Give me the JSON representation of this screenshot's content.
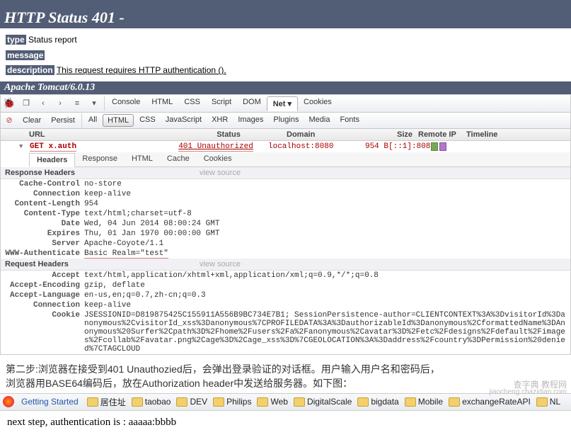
{
  "status": {
    "title": "HTTP Status 401 -",
    "type_label": "type",
    "type_value": "Status report",
    "message_label": "message",
    "description_label": "description",
    "description_value": "This request requires HTTP authentication ().",
    "server": "Apache Tomcat/6.0.13"
  },
  "firebug": {
    "top_tabs": [
      "Console",
      "HTML",
      "CSS",
      "Script",
      "DOM",
      "Net",
      "Cookies"
    ],
    "top_active": "Net",
    "row2_buttons": [
      "Clear",
      "Persist"
    ],
    "row2_filters": [
      "All",
      "HTML",
      "CSS",
      "JavaScript",
      "XHR",
      "Images",
      "Plugins",
      "Media",
      "Fonts"
    ],
    "row2_active": "HTML",
    "net_cols": [
      "URL",
      "Status",
      "Domain",
      "Size",
      "Remote IP",
      "Timeline"
    ],
    "req": {
      "method": "GET",
      "url": "x.auth",
      "status": "401 Unauthorized",
      "domain": "localhost:8080",
      "size": "954 B",
      "remote_ip": "[::1]:8080"
    },
    "subtabs": [
      "Headers",
      "Response",
      "HTML",
      "Cache",
      "Cookies"
    ],
    "subtab_active": "Headers",
    "response_headers_title": "Response Headers",
    "request_headers_title": "Request Headers",
    "view_source": "view source",
    "response_headers": [
      {
        "k": "Cache-Control",
        "v": "no-store"
      },
      {
        "k": "Connection",
        "v": "keep-alive"
      },
      {
        "k": "Content-Length",
        "v": "954"
      },
      {
        "k": "Content-Type",
        "v": "text/html;charset=utf-8"
      },
      {
        "k": "Date",
        "v": "Wed, 04 Jun 2014 08:00:24 GMT"
      },
      {
        "k": "Expires",
        "v": "Thu, 01 Jan 1970 00:00:00 GMT"
      },
      {
        "k": "Server",
        "v": "Apache-Coyote/1.1"
      },
      {
        "k": "WWW-Authenticate",
        "v": "Basic Realm=\"test\""
      }
    ],
    "request_headers": [
      {
        "k": "Accept",
        "v": "text/html,application/xhtml+xml,application/xml;q=0.9,*/*;q=0.8"
      },
      {
        "k": "Accept-Encoding",
        "v": "gzip, deflate"
      },
      {
        "k": "Accept-Language",
        "v": "en-us,en;q=0.7,zh-cn;q=0.3"
      },
      {
        "k": "Connection",
        "v": "keep-alive"
      },
      {
        "k": "Cookie",
        "v": "JSESSIONID=D819875425C155911A556B9BC734E7B1; SessionPersistence-author=CLIENTCONTEXT%3A%3DvisitorId%3Danonymous%2CvisitorId_xss%3Danonymous%7CPROFILEDATA%3A%3DauthorizableId%3Danonymous%2CformattedName%3DAnonymous%20Surfer%2Cpath%3D%2Fhome%2Fusers%2Fa%2Fanonymous%2Cavatar%3D%2Fetc%2Fdesigns%2Fdefault%2Fimages%2Fcollab%2Favatar.png%2Cage%3D%2Cage_xss%3D%7CGEOLOCATION%3A%3Daddress%2Fcountry%3DPermission%20denied%7CTAGCLOUD"
      }
    ]
  },
  "cn": {
    "line1": "第二步:浏览器在接受到401 Unauthozied后，会弹出登录验证的对话框。用户输入用户名和密码后，",
    "line2": "浏览器用BASE64编码后，放在Authorization header中发送给服务器。如下图："
  },
  "bookmarks": {
    "getting_started": "Getting Started",
    "items": [
      "居住址",
      "taobao",
      "DEV",
      "Philips",
      "Web",
      "DigitalScale",
      "bigdata",
      "Mobile",
      "exchangeRateAPI",
      "NL"
    ]
  },
  "nextstep": "next step, authentication is : aaaaa:bbbb",
  "watermark": {
    "l1": "查字典",
    "l2": "jiaocheng.chazidian.com",
    "l3": "教程网"
  }
}
